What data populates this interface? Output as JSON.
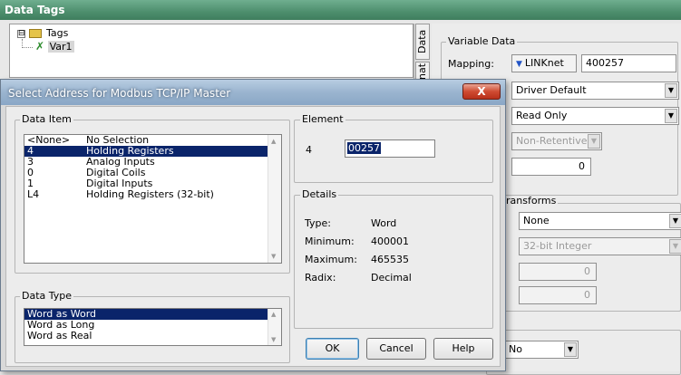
{
  "window": {
    "title": "Data Tags"
  },
  "tree": {
    "root_label": "Tags",
    "expander": "⊟",
    "child_label": "Var1",
    "child_icon": "x-var-icon"
  },
  "side_tabs": {
    "data": "Data",
    "format": "nat"
  },
  "variable_data": {
    "title": "Variable Data",
    "mapping_label": "Mapping:",
    "mapping_driver": "LINKnet",
    "mapping_address": "400257",
    "driver_option": "Driver Default",
    "access": "Read Only",
    "retentive": "Non-Retentive",
    "value": "0"
  },
  "transforms": {
    "title": "ransforms",
    "type": "None",
    "data_type": "32-bit Integer",
    "value_a": "0",
    "value_b": "0"
  },
  "bottom_field": "No",
  "dialog": {
    "title": "Select Address for Modbus TCP/IP Master",
    "close": "X",
    "data_item": {
      "title": "Data Item",
      "items": [
        {
          "code": "<None>",
          "name": "No Selection"
        },
        {
          "code": "4",
          "name": "Holding Registers"
        },
        {
          "code": "3",
          "name": "Analog Inputs"
        },
        {
          "code": "0",
          "name": "Digital Coils"
        },
        {
          "code": "1",
          "name": "Digital Inputs"
        },
        {
          "code": "L4",
          "name": "Holding Registers (32-bit)"
        }
      ],
      "selected_index": 1
    },
    "element": {
      "title": "Element",
      "prefix": "4",
      "value": "00257"
    },
    "details": {
      "title": "Details",
      "type_label": "Type:",
      "type_value": "Word",
      "min_label": "Minimum:",
      "min_value": "400001",
      "max_label": "Maximum:",
      "max_value": "465535",
      "radix_label": "Radix:",
      "radix_value": "Decimal"
    },
    "data_type": {
      "title": "Data Type",
      "items": [
        "Word as Word",
        "Word as Long",
        "Word as Real"
      ],
      "selected_index": 0
    },
    "buttons": {
      "ok": "OK",
      "cancel": "Cancel",
      "help": "Help"
    }
  },
  "colors": {
    "selection": "#0a246a",
    "titlebar": "#4d8e6d",
    "close": "#cf4b32"
  }
}
